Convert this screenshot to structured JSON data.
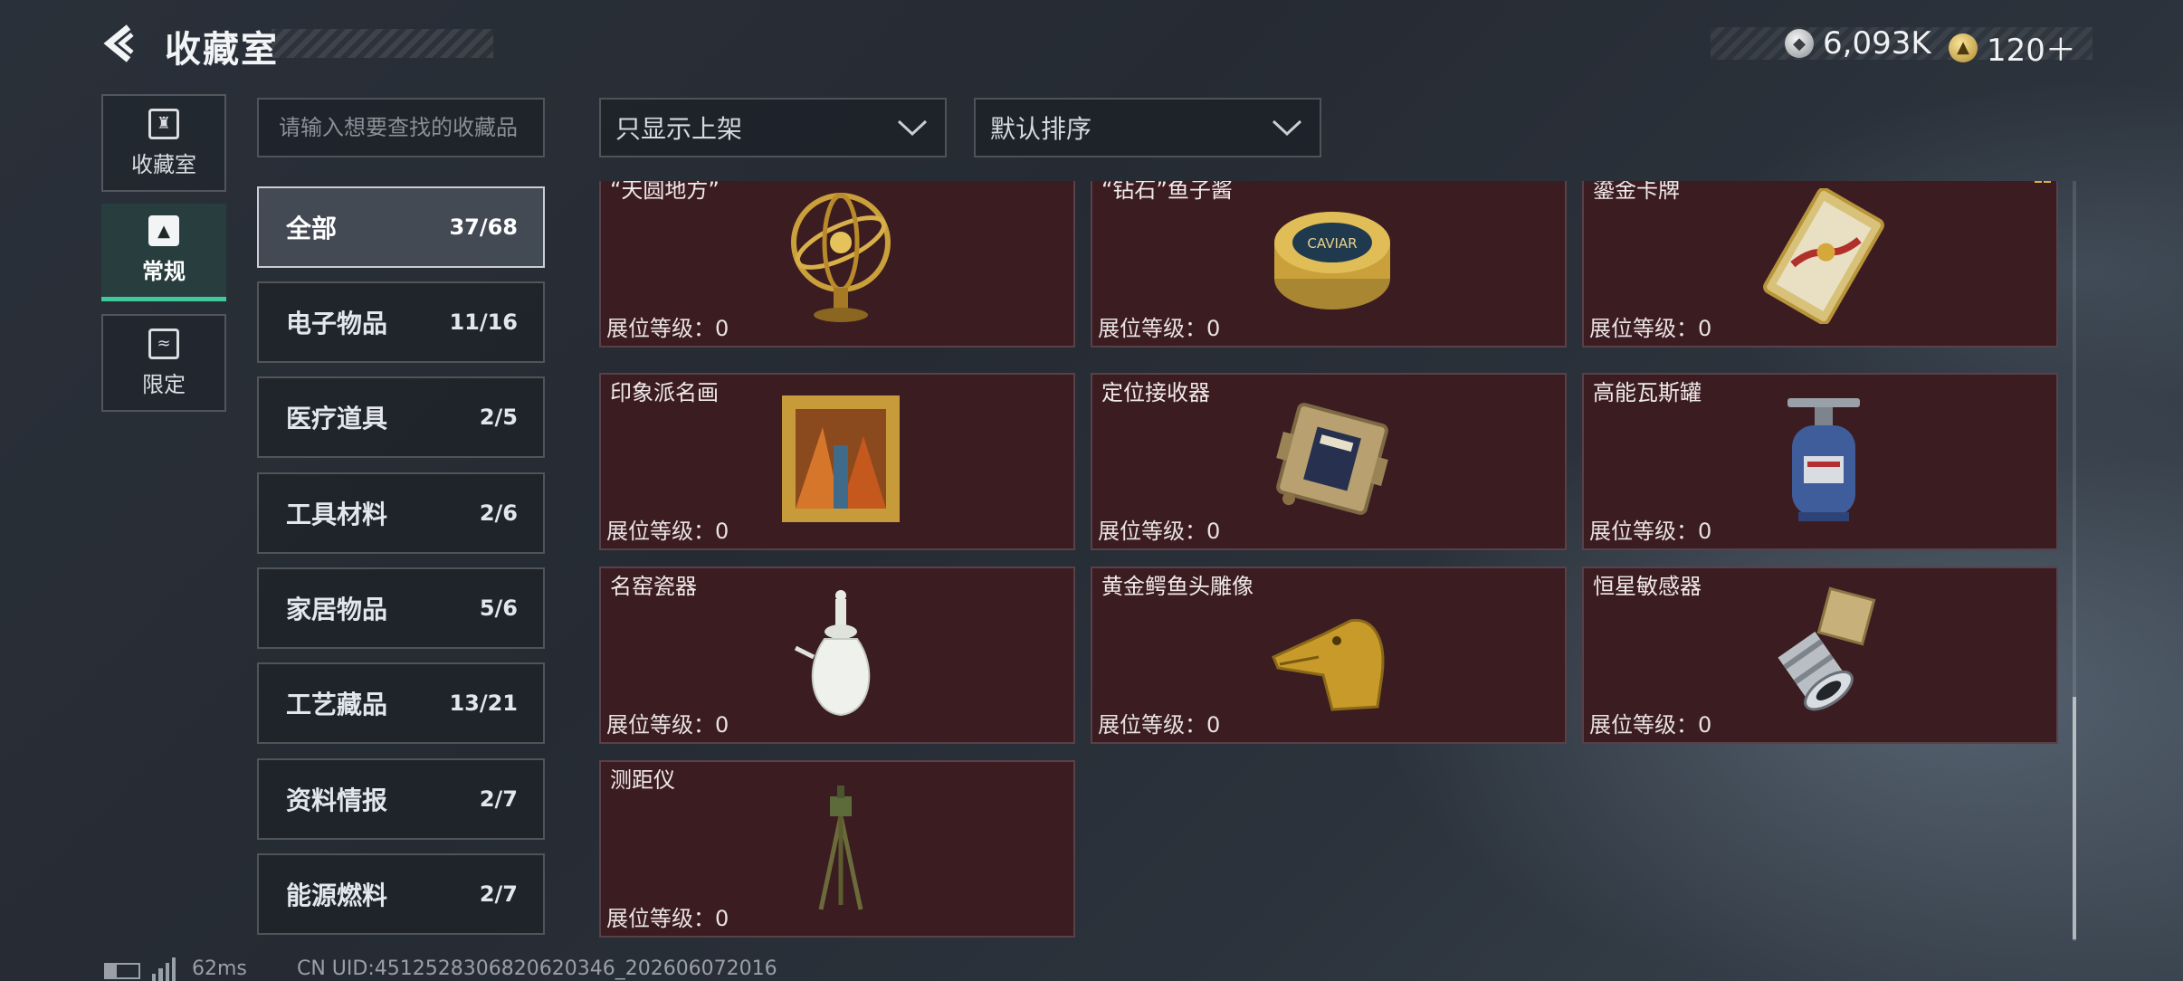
{
  "header": {
    "title": "收藏室",
    "currency_silver": "6,093K",
    "currency_gold": "120＋"
  },
  "nav": {
    "collection": "收藏室",
    "regular": "常规",
    "limited": "限定"
  },
  "search": {
    "placeholder": "请输入想要查找的收藏品"
  },
  "categories": [
    {
      "label": "全部",
      "count": "37/68"
    },
    {
      "label": "电子物品",
      "count": "11/16"
    },
    {
      "label": "医疗道具",
      "count": "2/5"
    },
    {
      "label": "工具材料",
      "count": "2/6"
    },
    {
      "label": "家居物品",
      "count": "5/6"
    },
    {
      "label": "工艺藏品",
      "count": "13/21"
    },
    {
      "label": "资料情报",
      "count": "2/7"
    },
    {
      "label": "能源燃料",
      "count": "2/7"
    }
  ],
  "filters": {
    "display_filter": "只显示上架",
    "sort": "默认排序"
  },
  "level_label": "展位等级：0",
  "items": [
    {
      "name": "“天圆地方”",
      "icon": "armillary-sphere-icon"
    },
    {
      "name": "“钻石”鱼子酱",
      "icon": "caviar-tin-icon"
    },
    {
      "name": "鎏金卡牌",
      "icon": "gilded-card-icon"
    },
    {
      "name": "印象派名画",
      "icon": "framed-painting-icon"
    },
    {
      "name": "定位接收器",
      "icon": "receiver-device-icon"
    },
    {
      "name": "高能瓦斯罐",
      "icon": "gas-canister-icon"
    },
    {
      "name": "名窑瓷器",
      "icon": "porcelain-vase-icon"
    },
    {
      "name": "黄金鳄鱼头雕像",
      "icon": "gold-crocodile-icon"
    },
    {
      "name": "恒星敏感器",
      "icon": "star-sensor-icon"
    },
    {
      "name": "测距仪",
      "icon": "rangefinder-icon"
    }
  ],
  "footer": {
    "ping": "62ms",
    "uid": "CN UID:4512528306820620346_202606072016"
  },
  "colors": {
    "card_bg": "#3b1c21",
    "active_tab": "#41c99a",
    "gold": "#c9a03a"
  }
}
